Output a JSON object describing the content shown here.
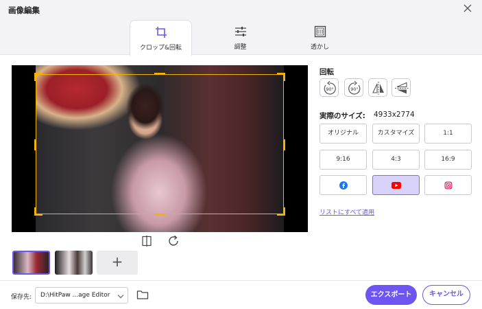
{
  "window": {
    "title": "画像編集"
  },
  "tabs": [
    {
      "label": "クロップ&回転",
      "icon": "crop-icon",
      "active": true
    },
    {
      "label": "調整",
      "icon": "sliders-icon",
      "active": false
    },
    {
      "label": "透かし",
      "icon": "watermark-icon",
      "active": false
    }
  ],
  "rotate": {
    "title": "回転",
    "buttons": [
      {
        "label": "90°",
        "icon": "rotate-left-icon"
      },
      {
        "label": "90°",
        "icon": "rotate-right-icon"
      },
      {
        "icon": "flip-horizontal-icon"
      },
      {
        "icon": "flip-vertical-icon"
      }
    ]
  },
  "actual_size": {
    "label": "実際のサイズ:",
    "value": "4933x2774"
  },
  "ratios": {
    "original": "オリジナル",
    "custom": "カスタマイズ",
    "r1_1": "1:1",
    "r9_16": "9:16",
    "r4_3": "4:3",
    "r16_9": "16:9",
    "social": [
      "facebook-icon",
      "youtube-icon",
      "instagram-icon"
    ],
    "selected": "youtube"
  },
  "apply_all": "リストにすべて適用",
  "thumbnails": {
    "count": 2,
    "selected_index": 0,
    "add_label": "+"
  },
  "footer": {
    "save_label": "保存先:",
    "path_value": "D:\\HitPaw ...age Editor",
    "export_label": "エクスポート",
    "cancel_label": "キャンセル"
  },
  "colors": {
    "accent": "#6c55f0",
    "crop_frame": "#f5b301",
    "selected_ratio_bg": "#d9d3fc"
  }
}
